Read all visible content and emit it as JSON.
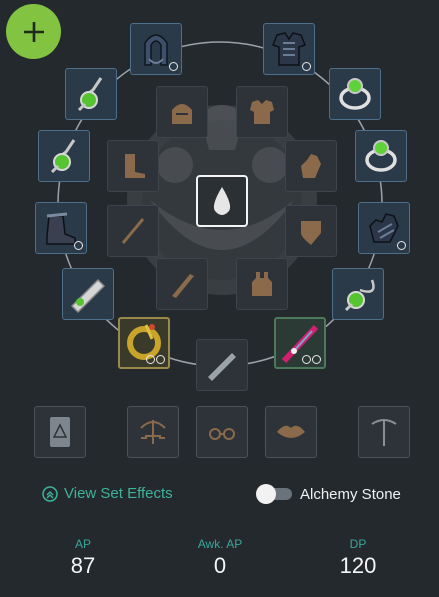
{
  "toolbar": {
    "add_icon": "plus-icon"
  },
  "gear": {
    "outer_slots": [
      {
        "name": "helmet-slot",
        "icon": "helmet-icon",
        "dots": 1
      },
      {
        "name": "armor-slot",
        "icon": "armor-icon",
        "dots": 1
      },
      {
        "name": "necklace-slot",
        "icon": "necklace-icon",
        "dots": 0
      },
      {
        "name": "ring-slot-1",
        "icon": "ring-icon",
        "dots": 0
      },
      {
        "name": "earring-slot-1",
        "icon": "earring-icon",
        "dots": 0
      },
      {
        "name": "ring-slot-2",
        "icon": "ring-icon",
        "dots": 0
      },
      {
        "name": "earring-slot-2",
        "icon": "earring-icon",
        "dots": 0
      },
      {
        "name": "gloves-slot",
        "icon": "gloves-icon",
        "dots": 1
      },
      {
        "name": "shoes-slot",
        "icon": "shoes-icon",
        "dots": 1
      },
      {
        "name": "belt-slot",
        "icon": "belt-icon",
        "dots": 0
      },
      {
        "name": "alchemy-stone-slot",
        "icon": "alchemy-stone-icon",
        "dots": 0
      },
      {
        "name": "sub-weapon-slot",
        "icon": "sub-weapon-icon",
        "dots": 2
      },
      {
        "name": "awakening-weapon-slot",
        "icon": "awakening-weapon-icon",
        "dots": 2
      }
    ],
    "inner_slots": [
      {
        "name": "costume-helmet-slot",
        "icon": "costume-helmet-icon"
      },
      {
        "name": "costume-armor-slot",
        "icon": "costume-armor-icon"
      },
      {
        "name": "costume-shoes-slot",
        "icon": "boot-icon"
      },
      {
        "name": "costume-gloves-slot",
        "icon": "glove-icon"
      },
      {
        "name": "costume-main-weapon-slot",
        "icon": "staff-icon"
      },
      {
        "name": "costume-sub-weapon-slot",
        "icon": "shield-icon"
      },
      {
        "name": "costume-awakening-slot",
        "icon": "sword-icon"
      },
      {
        "name": "costume-underwear-slot",
        "icon": "underwear-icon"
      },
      {
        "name": "costume-main-weapon-2-slot",
        "icon": "blade-icon"
      }
    ],
    "center_slot": {
      "name": "selected-slot",
      "icon": "teardrop-icon"
    }
  },
  "tools": [
    {
      "name": "lightstone-book-slot",
      "icon": "book-icon"
    },
    {
      "name": "lantern-slot",
      "icon": "scales-icon"
    },
    {
      "name": "glasses-slot",
      "icon": "glasses-icon"
    },
    {
      "name": "lips-slot",
      "icon": "lips-icon"
    },
    {
      "name": "pickaxe-slot",
      "icon": "pickaxe-icon"
    }
  ],
  "set_effects": {
    "label": "View Set Effects",
    "icon": "double-chevron-up-icon"
  },
  "alchemy_toggle": {
    "label": "Alchemy Stone",
    "enabled": false
  },
  "stats": [
    {
      "label": "AP",
      "value": "87"
    },
    {
      "label": "Awk. AP",
      "value": "0"
    },
    {
      "label": "DP",
      "value": "120"
    }
  ],
  "colors": {
    "background": "#24292e",
    "accent_green": "#82c341",
    "teal": "#3eb39a",
    "gem_green": "#7ee34a"
  }
}
